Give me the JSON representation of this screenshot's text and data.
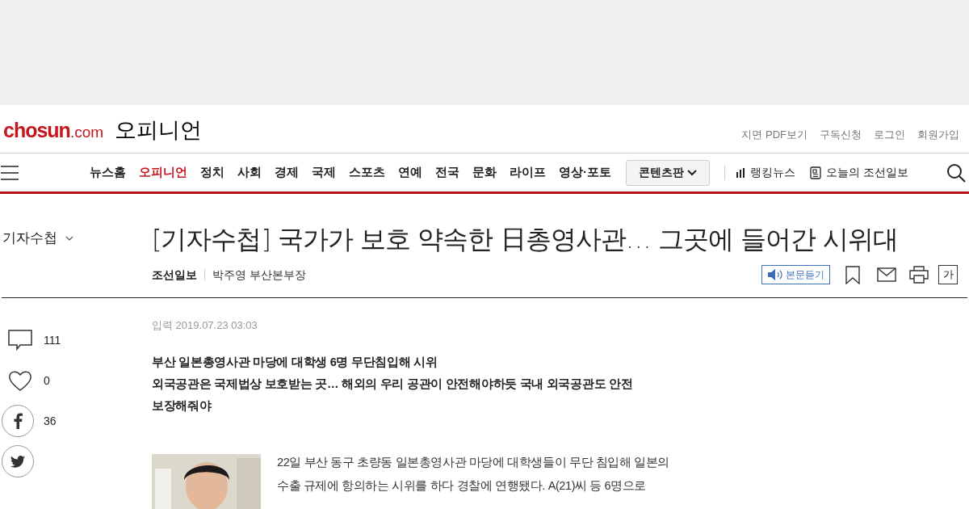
{
  "logo": {
    "main": "chosun",
    "suffix": ".com"
  },
  "section_title": "오피니언",
  "top_links": [
    "지면 PDF보기",
    "구독신청",
    "로그인",
    "회원가입"
  ],
  "nav": [
    {
      "label": "뉴스홈",
      "selected": false
    },
    {
      "label": "오피니언",
      "selected": true
    },
    {
      "label": "정치",
      "selected": false
    },
    {
      "label": "사회",
      "selected": false
    },
    {
      "label": "경제",
      "selected": false
    },
    {
      "label": "국제",
      "selected": false
    },
    {
      "label": "스포츠",
      "selected": false
    },
    {
      "label": "연예",
      "selected": false
    },
    {
      "label": "전국",
      "selected": false
    },
    {
      "label": "문화",
      "selected": false
    },
    {
      "label": "라이프",
      "selected": false
    },
    {
      "label": "영상·포토",
      "selected": false
    }
  ],
  "content_menu": "콘텐츠판",
  "ranking_news": "랭킹뉴스",
  "today_paper": "오늘의 조선일보",
  "category": "기자수첩",
  "headline": "[기자수첩] 국가가 보호 약속한 日총영사관… 그곳에 들어간 시위대",
  "publisher": "조선일보",
  "author": "박주영 부산본부장",
  "listen_button": "본문듣기",
  "font_button": "가",
  "published": "입력 2019.07.23 03:03",
  "subheads": [
    "부산 일본총영사관 마당에 대학생 6명 무단침입해 시위",
    "외국공관은 국제법상 보호받는 곳… 해외의 우리 공관이 안전해야하듯 국내 외국공관도 안전 보장해줘야"
  ],
  "social": [
    {
      "kind": "comment",
      "count": "111"
    },
    {
      "kind": "like",
      "count": "0"
    },
    {
      "kind": "facebook",
      "count": "36"
    },
    {
      "kind": "twitter"
    }
  ],
  "body": "22일 부산 동구 초량동 일본총영사관 마당에 대학생들이 무단 침입해 일본의 수출 규제에 항의하는 시위를 하다 경찰에 연행됐다. A(21)씨 등 6명으로"
}
